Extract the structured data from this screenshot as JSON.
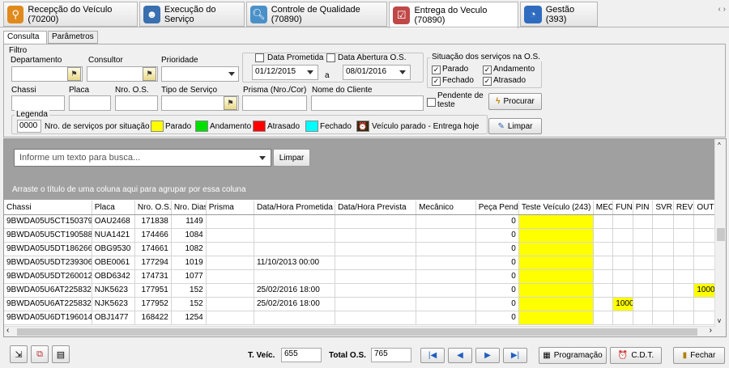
{
  "main_tabs": [
    {
      "label": "Recepção do Veículo (70200)",
      "icon": "location-pin-icon",
      "color": "#e08a1e"
    },
    {
      "label": "Execução do Serviço",
      "icon": "mechanic-icon",
      "color": "#3a6fb0"
    },
    {
      "label": "Controle de Qualidade (70890)",
      "icon": "magnifier-icon",
      "color": "#4a90c8"
    },
    {
      "label": "Entrega do Veculo (70890)",
      "icon": "clipboard-icon",
      "color": "#c04848"
    },
    {
      "label": "Gestão (393)",
      "icon": "gauge-icon",
      "color": "#2f6cc0"
    }
  ],
  "window_controls": "‹ ›",
  "sub_tabs": [
    "Consulta",
    "Parâmetros"
  ],
  "filter": {
    "title": "Filtro",
    "departamento_label": "Departamento",
    "consultor_label": "Consultor",
    "prioridade_label": "Prioridade",
    "data_prometida_label": "Data Prometida",
    "data_abertura_label": "Data Abertura O.S.",
    "date_from": "01/12/2015",
    "date_sep": "a",
    "date_to": "08/01/2016",
    "situacao_label": "Situação dos serviços na O.S.",
    "situacao": [
      {
        "label": "Parado",
        "checked": true
      },
      {
        "label": "Andamento",
        "checked": true
      },
      {
        "label": "Fechado",
        "checked": true
      },
      {
        "label": "Atrasado",
        "checked": true
      }
    ],
    "chassi_label": "Chassi",
    "placa_label": "Placa",
    "nro_os_label": "Nro. O.S.",
    "tipo_servico_label": "Tipo de Serviço",
    "prisma_label": "Prisma (Nro./Cor)",
    "nome_cliente_label": "Nome do Cliente",
    "pendente_label": "Pendente de teste",
    "procurar_label": "Procurar",
    "limpar_label": "Limpar"
  },
  "legend": {
    "title": "Legenda",
    "count": "0000",
    "count_label": "Nro. de serviços por situação",
    "items": [
      {
        "label": "Parado",
        "color": "#ffff00"
      },
      {
        "label": "Andamento",
        "color": "#00e000"
      },
      {
        "label": "Atrasado",
        "color": "#ff0000"
      },
      {
        "label": "Fechado",
        "color": "#00ffff"
      }
    ],
    "today_label": "Veículo parado - Entrega hoje"
  },
  "grid": {
    "search_placeholder": "Informe um texto para busca...",
    "search_clear": "Limpar",
    "group_hint": "Arraste o título de uma coluna aqui para agrupar por essa coluna",
    "columns": [
      "Chassi",
      "Placa",
      "Nro. O.S.",
      "Nro. Dias",
      "Prisma",
      "Data/Hora Prometida",
      "Data/Hora Prevista",
      "Mecânico",
      "Peça Pend.",
      "Teste Veículo (243)",
      "MEC",
      "FUN",
      "PIN",
      "SVR",
      "REV",
      "OUT"
    ],
    "rows": [
      [
        "9BWDA05U5CT150379",
        "OAU2468",
        "171838",
        "1149",
        "",
        "",
        "",
        "",
        "0",
        "",
        "",
        "",
        "",
        "",
        "",
        ""
      ],
      [
        "9BWDA05U5CT190588",
        "NUA1421",
        "174466",
        "1084",
        "",
        "",
        "",
        "",
        "0",
        "",
        "",
        "",
        "",
        "",
        "",
        ""
      ],
      [
        "9BWDA05U5DT186266",
        "OBG9530",
        "174661",
        "1082",
        "",
        "",
        "",
        "",
        "0",
        "",
        "",
        "",
        "",
        "",
        "",
        ""
      ],
      [
        "9BWDA05U5DT239306",
        "OBE0061",
        "177294",
        "1019",
        "",
        "11/10/2013 00:00",
        "",
        "",
        "0",
        "",
        "",
        "",
        "",
        "",
        "",
        ""
      ],
      [
        "9BWDA05U5DT260012",
        "OBD6342",
        "174731",
        "1077",
        "",
        "",
        "",
        "",
        "0",
        "",
        "",
        "",
        "",
        "",
        "",
        ""
      ],
      [
        "9BWDA05U6AT225832",
        "NJK5623",
        "177951",
        "152",
        "",
        "25/02/2016 18:00",
        "",
        "",
        "0",
        "",
        "",
        "",
        "",
        "",
        "",
        "1000"
      ],
      [
        "9BWDA05U6AT225832",
        "NJK5623",
        "177952",
        "152",
        "",
        "25/02/2016 18:00",
        "",
        "",
        "0",
        "",
        "",
        "1000",
        "",
        "",
        "",
        ""
      ],
      [
        "9BWDA05U6DT196014",
        "OBJ1477",
        "168422",
        "1254",
        "",
        "",
        "",
        "",
        "0",
        "",
        "",
        "",
        "",
        "",
        "",
        ""
      ]
    ]
  },
  "bottom": {
    "tveic_label": "T. Veíc.",
    "tveic_value": "655",
    "total_os_label": "Total O.S.",
    "total_os_value": "765",
    "programacao_label": "Programação",
    "cdt_label": "C.D.T.",
    "fechar_label": "Fechar"
  }
}
